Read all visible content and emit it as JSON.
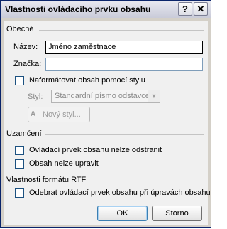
{
  "window": {
    "title": "Vlastnosti ovládacího prvku obsahu",
    "help_label": "?",
    "close_label": "✕"
  },
  "general": {
    "section_label": "Obecné",
    "name_label": "Název:",
    "name_value": "Jméno zaměstnace",
    "tag_label": "Značka:",
    "tag_value": "",
    "format_checkbox_label": "Naformátovat obsah pomocí stylu",
    "format_checked": false,
    "style_label": "Styl:",
    "style_value": "Standardní písmo odstavce",
    "new_style_label": "Nový styl...",
    "new_style_icon": "new-style-icon"
  },
  "locking": {
    "section_label": "Uzamčení",
    "no_delete_label": "Ovládací prvek obsahu nelze odstranit",
    "no_delete_checked": false,
    "no_edit_label": "Obsah nelze upravit",
    "no_edit_checked": false
  },
  "rtf": {
    "section_label": "Vlastnosti formátu RTF",
    "remove_label": "Odebrat ovládací prvek obsahu při úpravách obsahu",
    "remove_checked": false
  },
  "footer": {
    "ok_label": "OK",
    "cancel_label": "Storno"
  },
  "colors": {
    "titlebar": "#dadbe6",
    "dialog_bg": "#f0f0f0",
    "input_border": "#7f9db9",
    "checkbox_border": "#1c5180"
  }
}
